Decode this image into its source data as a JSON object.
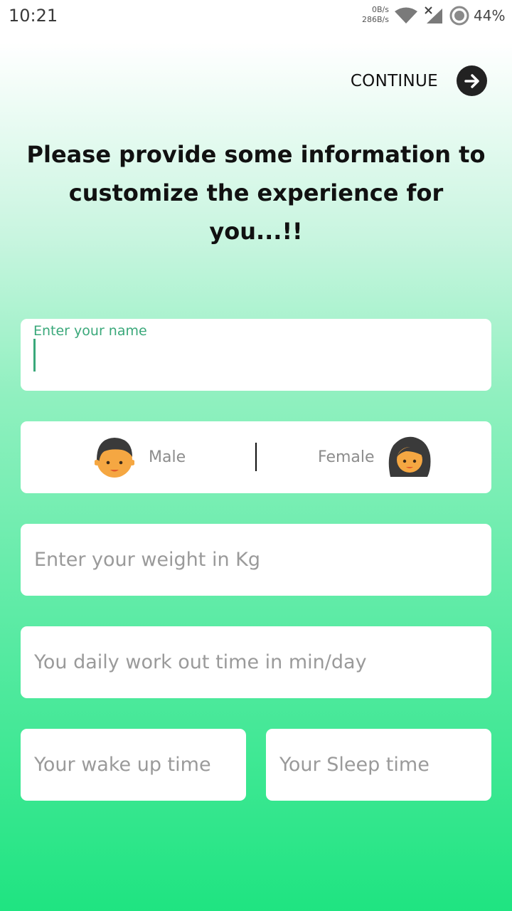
{
  "status_bar": {
    "time": "10:21",
    "net_up": "0B/s",
    "net_down": "286B/s",
    "battery": "44%"
  },
  "header": {
    "continue_label": "CONTINUE"
  },
  "headline": "Please provide some information to customize the experience for you...!!",
  "form": {
    "name_label": "Enter your name",
    "name_value": "",
    "gender": {
      "male_label": "Male",
      "female_label": "Female"
    },
    "weight_placeholder": "Enter your weight in Kg",
    "workout_placeholder": "You daily work out time in min/day",
    "wake_placeholder": "Your wake up time",
    "sleep_placeholder": "Your Sleep time"
  },
  "colors": {
    "accent": "#3aa87a",
    "gradient_bottom": "#1fe481"
  }
}
